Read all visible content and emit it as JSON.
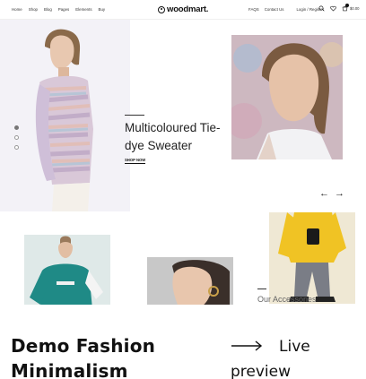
{
  "header": {
    "nav": [
      "Home",
      "Shop",
      "Blog",
      "Pages",
      "Elements",
      "Buy"
    ],
    "logo_text": "woodmart.",
    "right_links": [
      "FAQS",
      "Contact Us",
      "Login / Register"
    ],
    "cart_price": "$0.00"
  },
  "hero": {
    "title": "Multicoloured Tie-dye Sweater",
    "shop_now": "SHOP NOW",
    "slides": 3,
    "active_slide": 1
  },
  "grid": {
    "accessories_label": "Our Accessories"
  },
  "caption": {
    "demo_title": "Demo Fashion Minimalism",
    "live_preview": "Live preview"
  },
  "colors": {
    "accent": "#111111",
    "hero_bg": "#f3f2f7"
  }
}
